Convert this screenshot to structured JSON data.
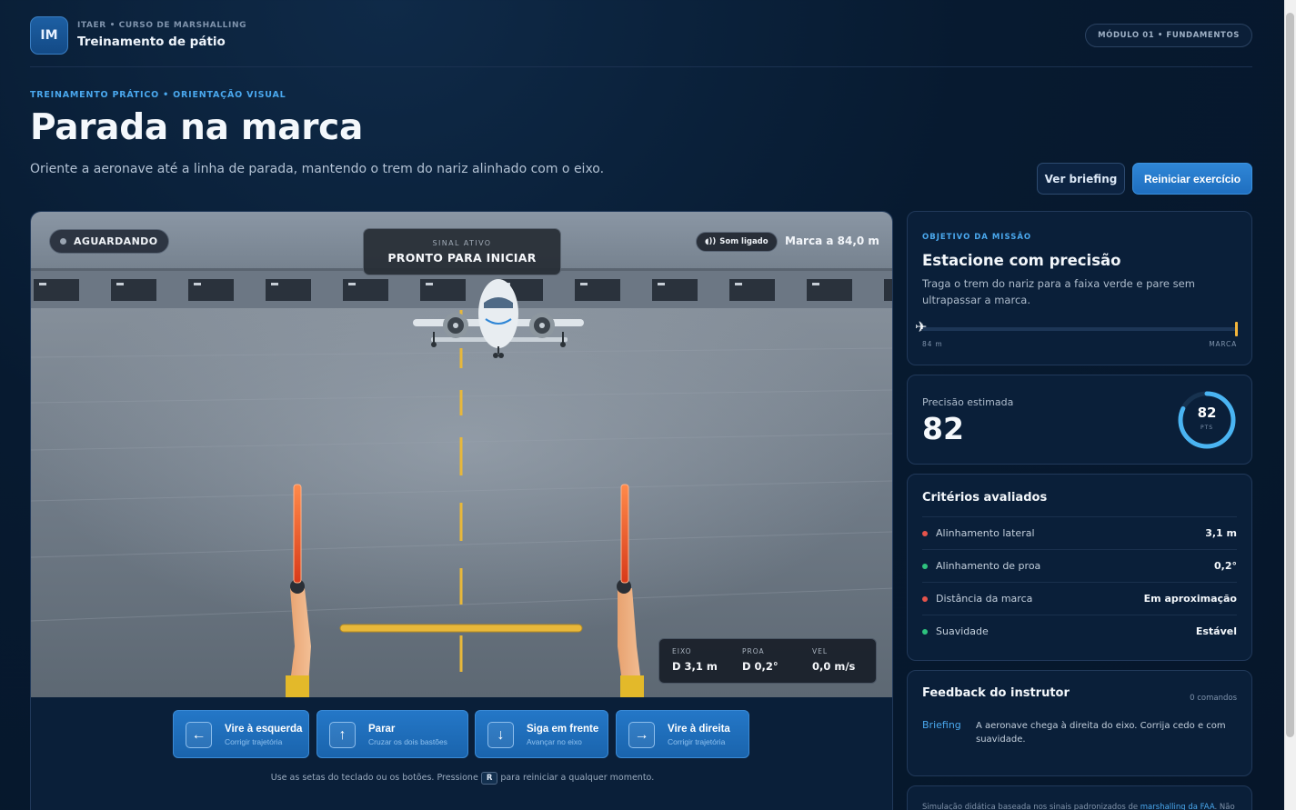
{
  "header": {
    "logo_text": "IM",
    "brand_sub": "ITAER • CURSO DE MARSHALLING",
    "brand_title": "Treinamento de pátio",
    "module_badge": "MÓDULO 01 • FUNDAMENTOS"
  },
  "hero": {
    "eyebrow": "TREINAMENTO PRÁTICO • ORIENTAÇÃO VISUAL",
    "title": "Parada na marca",
    "subtitle": "Oriente a aeronave até a linha de parada, mantendo o trem do nariz alinhado com o eixo.",
    "btn_briefing": "Ver briefing",
    "btn_restart": "Reiniciar exercício"
  },
  "sim": {
    "status": "AGUARDANDO",
    "signal_label": "SINAL ATIVO",
    "signal_value": "PRONTO PARA INICIAR",
    "sound": "Som ligado",
    "sound_icon": "speaker-icon",
    "mark": "Marca a 84,0 m",
    "telemetry": [
      {
        "label": "EIXO",
        "value": "D 3,1 m"
      },
      {
        "label": "PROA",
        "value": "D 0,2°"
      },
      {
        "label": "VEL",
        "value": "0,0 m/s"
      }
    ],
    "controls": [
      {
        "icon": "←",
        "title": "Vire à esquerda",
        "sub": "Corrigir trajetória"
      },
      {
        "icon": "↑",
        "title": "Parar",
        "sub": "Cruzar os dois bastões"
      },
      {
        "icon": "↓",
        "title": "Siga em frente",
        "sub": "Avançar no eixo"
      },
      {
        "icon": "→",
        "title": "Vire à direita",
        "sub": "Corrigir trajetória"
      }
    ],
    "hint_before": "Use as setas do teclado ou os botões. Pressione",
    "hint_key": "R",
    "hint_after": "para reiniciar a qualquer momento."
  },
  "objective": {
    "eyebrow": "OBJETIVO DA MISSÃO",
    "title": "Estacione com precisão",
    "desc": "Traga o trem do nariz para a faixa verde e pare sem ultrapassar a marca.",
    "track_left": "84 m",
    "track_right": "MARCA",
    "progress": 0
  },
  "precision": {
    "label": "Precisão estimada",
    "value": "82",
    "ring_value": "82",
    "ring_unit": "PTS",
    "fraction": 0.82
  },
  "criteria": {
    "title": "Critérios avaliados",
    "rows": [
      {
        "name": "Alinhamento lateral",
        "value": "3,1 m",
        "color": "#e5534b"
      },
      {
        "name": "Alinhamento de proa",
        "value": "0,2°",
        "color": "#2ec27e"
      },
      {
        "name": "Distância da marca",
        "value": "Em aproximação",
        "color": "#e5534b"
      },
      {
        "name": "Suavidade",
        "value": "Estável",
        "color": "#2ec27e"
      }
    ]
  },
  "feedback": {
    "title": "Feedback do instrutor",
    "count": "0 comandos",
    "tag": "Briefing",
    "text": "A aeronave chega à direita do eixo. Corrija cedo e com suavidade."
  },
  "footnote": {
    "before": "Simulação didática baseada nos sinais padronizados de",
    "link": "marshalling da FAA",
    "after": ". Não"
  },
  "colors": {
    "accent": "#2f86d6",
    "centerline": "#e8b83a",
    "wand": "#ff5a2a"
  }
}
